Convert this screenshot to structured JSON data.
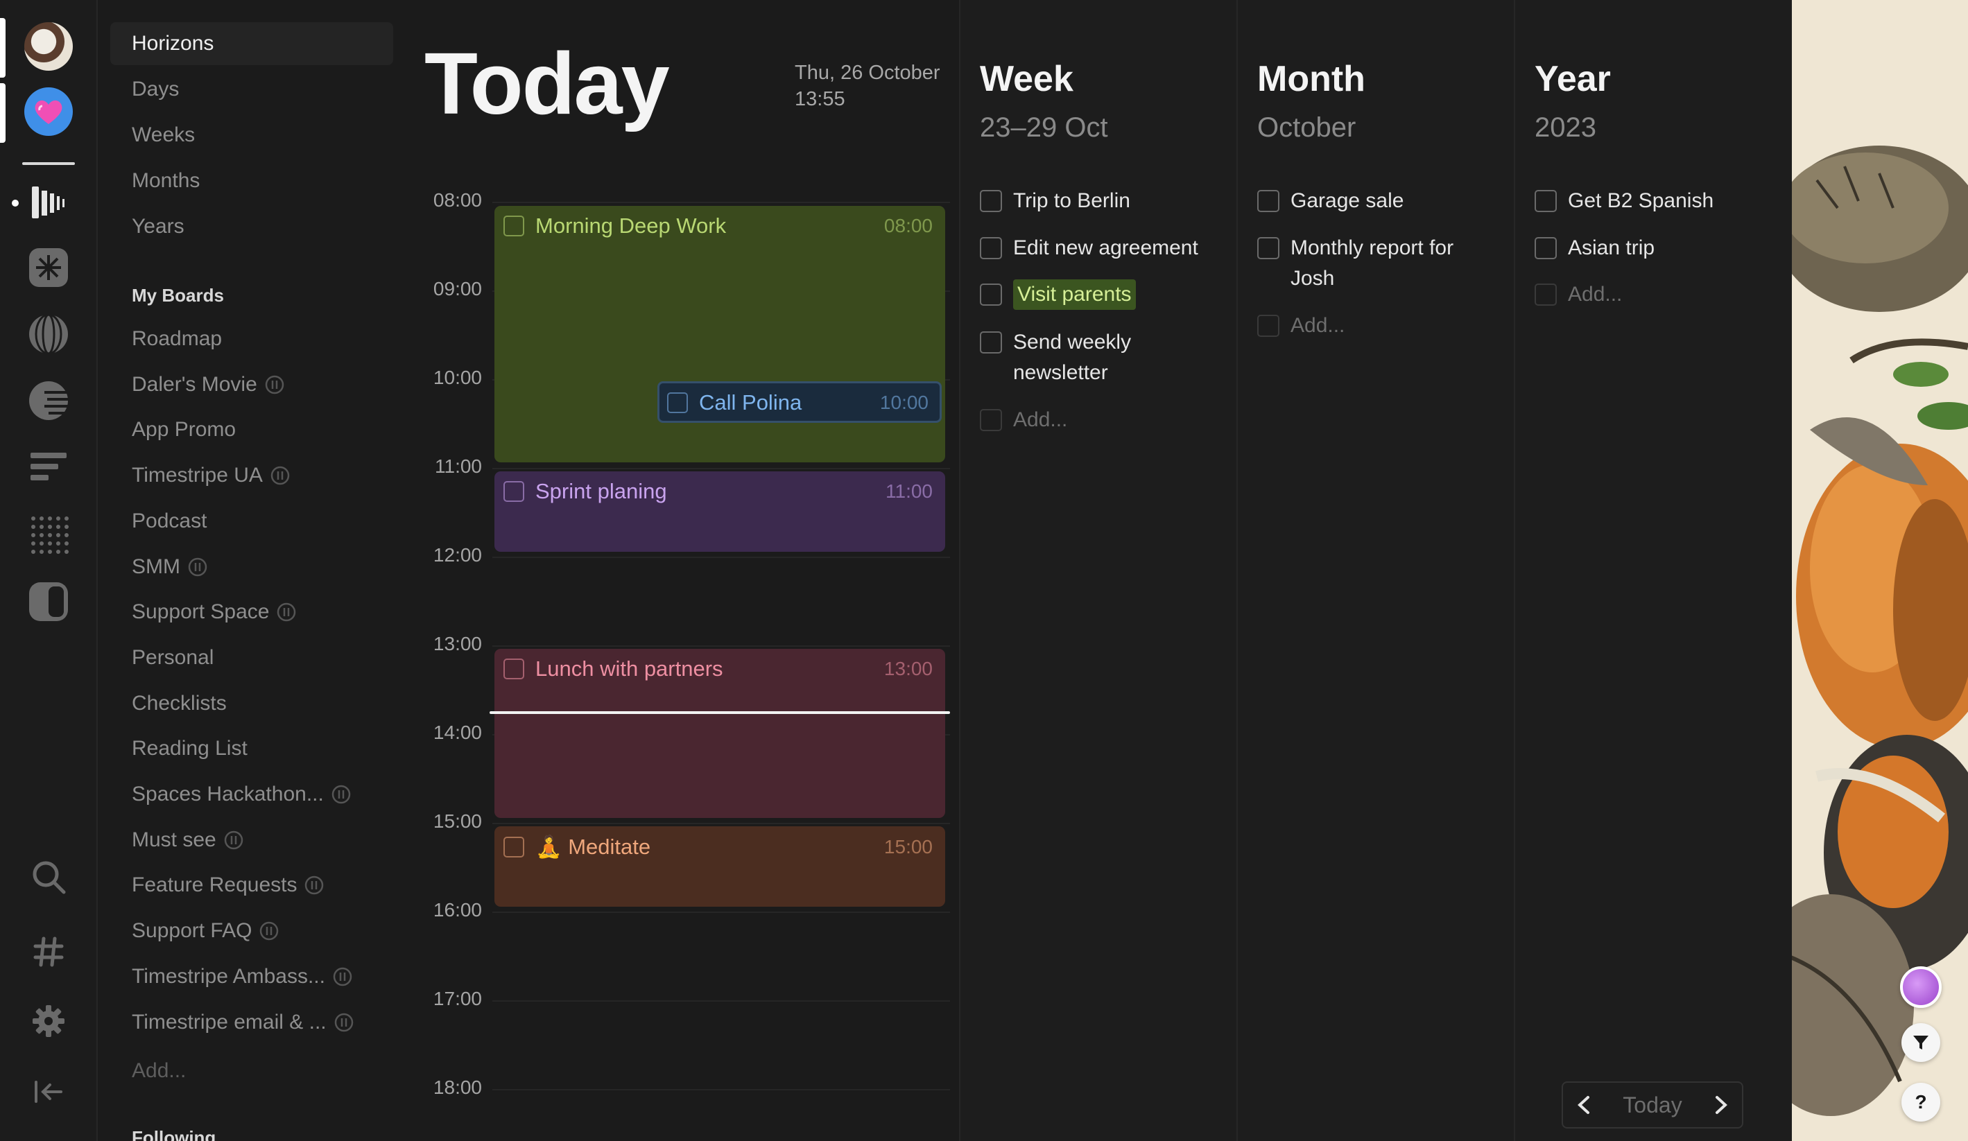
{
  "sidebar": {
    "nav": [
      "Horizons",
      "Days",
      "Weeks",
      "Months",
      "Years"
    ],
    "boards_title": "My Boards",
    "boards": [
      {
        "label": "Roadmap",
        "shared": false
      },
      {
        "label": "Daler's Movie",
        "shared": true
      },
      {
        "label": "App Promo",
        "shared": false
      },
      {
        "label": "Timestripe UA",
        "shared": true
      },
      {
        "label": "Podcast",
        "shared": false
      },
      {
        "label": "SMM",
        "shared": true
      },
      {
        "label": "Support Space",
        "shared": true
      },
      {
        "label": "Personal",
        "shared": false
      },
      {
        "label": "Checklists",
        "shared": false
      },
      {
        "label": "Reading List",
        "shared": false
      },
      {
        "label": "Spaces Hackathon...",
        "shared": true
      },
      {
        "label": "Must see",
        "shared": true
      },
      {
        "label": "Feature Requests",
        "shared": true
      },
      {
        "label": "Support FAQ",
        "shared": true
      },
      {
        "label": "Timestripe Ambass...",
        "shared": true
      },
      {
        "label": "Timestripe email & ...",
        "shared": true
      }
    ],
    "add_label": "Add...",
    "following_title": "Following"
  },
  "today": {
    "title": "Today",
    "date_line1": "Thu, 26 October",
    "date_line2": "13:55",
    "hours": [
      "08:00",
      "09:00",
      "10:00",
      "11:00",
      "12:00",
      "13:00",
      "14:00",
      "15:00",
      "16:00",
      "17:00",
      "18:00"
    ],
    "events": [
      {
        "title": "Morning Deep Work",
        "time": "08:00",
        "color": "#3a4a1d",
        "text_color": "#b9d873"
      },
      {
        "title": "Call Polina",
        "time": "10:00",
        "color": "#1a2b3d",
        "text_color": "#7fb5ee"
      },
      {
        "title": "Sprint planing",
        "time": "11:00",
        "color": "#3c2a4e",
        "text_color": "#c9a3ee"
      },
      {
        "title": "Lunch with partners",
        "time": "13:00",
        "color": "#4a2630",
        "text_color": "#ee8fa2"
      },
      {
        "title": "🧘 Meditate",
        "time": "15:00",
        "color": "#4b2d20",
        "text_color": "#efa77c"
      }
    ]
  },
  "week": {
    "title": "Week",
    "subtitle": "23–29 Oct",
    "tasks": [
      "Trip to Berlin",
      "Edit new agreement",
      "Visit parents",
      "Send weekly newsletter"
    ],
    "add_label": "Add..."
  },
  "month": {
    "title": "Month",
    "subtitle": "October",
    "tasks": [
      "Garage sale",
      "Monthly report for Josh"
    ],
    "add_label": "Add..."
  },
  "year": {
    "title": "Year",
    "subtitle": "2023",
    "tasks": [
      "Get B2 Spanish",
      "Asian trip"
    ],
    "add_label": "Add..."
  },
  "bottom_nav": {
    "today_label": "Today"
  },
  "icons": {
    "rail": [
      "user-avatar-icon",
      "heart-workspace-icon",
      "horizons-icon",
      "asterisk-icon",
      "globe-icon",
      "half-moon-icon",
      "lines-icon",
      "dots-grid-icon",
      "contrast-icon",
      "search-icon",
      "hashtag-icon",
      "gear-icon",
      "collapse-icon"
    ],
    "floating": [
      "color-theme-icon",
      "filter-icon",
      "help-icon"
    ]
  },
  "colors": {
    "accent": "#3b5520",
    "background": "#1b1b1b"
  }
}
